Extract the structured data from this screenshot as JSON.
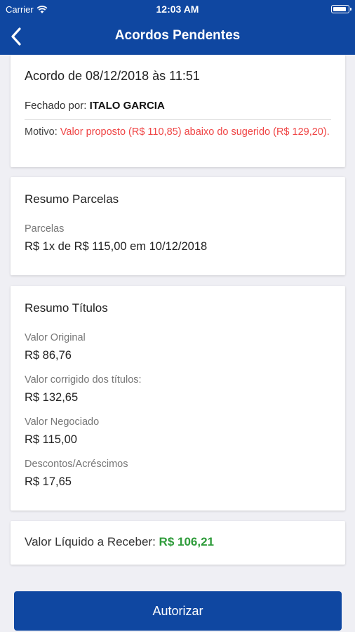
{
  "status_bar": {
    "carrier": "Carrier",
    "time": "12:03 AM"
  },
  "nav": {
    "title": "Acordos Pendentes",
    "back_icon": "chevron-left-icon"
  },
  "acordo": {
    "title": "Acordo de 08/12/2018 às 11:51",
    "fechado_label": "Fechado por:",
    "fechado_name": "ITALO GARCIA",
    "motivo_label": "Motivo:",
    "motivo_text": "Valor proposto (R$ 110,85) abaixo do sugerido (R$ 129,20)."
  },
  "resumo_parcelas": {
    "title": "Resumo Parcelas",
    "parcelas_label": "Parcelas",
    "parcelas_value": "R$ 1x de R$ 115,00 em 10/12/2018"
  },
  "resumo_titulos": {
    "title": "Resumo Títulos",
    "items": [
      {
        "label": "Valor Original",
        "value": "R$ 86,76"
      },
      {
        "label": "Valor corrigido dos títulos:",
        "value": "R$ 132,65"
      },
      {
        "label": "Valor Negociado",
        "value": "R$ 115,00"
      },
      {
        "label": "Descontos/Acréscimos",
        "value": "R$ 17,65"
      }
    ]
  },
  "liquido": {
    "label": "Valor Líquido a Receber:",
    "value": "R$ 106,21"
  },
  "actions": {
    "authorize_label": "Autorizar"
  },
  "colors": {
    "primary": "#0f47a1",
    "alert": "#ef4444",
    "positive": "#2e9b3a",
    "background": "#efeff4"
  }
}
